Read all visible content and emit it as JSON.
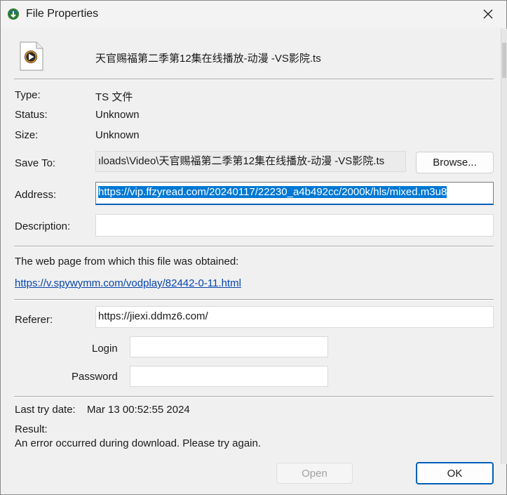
{
  "window": {
    "title": "File Properties",
    "app_icon": "idm-logo-icon",
    "close_icon": "close-icon"
  },
  "file": {
    "icon": "video-file-icon",
    "name": "天官赐福第二季第12集在线播放-动漫 -VS影院.ts"
  },
  "info": {
    "type_label": "Type:",
    "type_value": "TS 文件",
    "status_label": "Status:",
    "status_value": "Unknown",
    "size_label": "Size:",
    "size_value": "Unknown"
  },
  "save_to": {
    "label": "Save To:",
    "value": "ıloads\\Video\\天官赐福第二季第12集在线播放-动漫 -VS影院.ts",
    "browse_label": "Browse..."
  },
  "address": {
    "label": "Address:",
    "value": "https://vip.ffzyread.com/20240117/22230_a4b492cc/2000k/hls/mixed.m3u8"
  },
  "description": {
    "label": "Description:",
    "value": ""
  },
  "webpage": {
    "label": "The web page from which this file was obtained:",
    "url": "https://v.spywymm.com/vodplay/82442-0-11.html"
  },
  "referer": {
    "label": "Referer:",
    "value": "https://jiexi.ddmz6.com/"
  },
  "login": {
    "label": "Login",
    "value": ""
  },
  "password": {
    "label": "Password",
    "value": ""
  },
  "last_try": {
    "label": "Last try date:",
    "value": "Mar 13 00:52:55 2024"
  },
  "result": {
    "label": "Result:",
    "value": "An error occurred during download. Please try again."
  },
  "buttons": {
    "open_label": "Open",
    "ok_label": "OK"
  },
  "colors": {
    "selection": "#0078d4",
    "link": "#0645ad",
    "focus_accent": "#005fb8"
  }
}
